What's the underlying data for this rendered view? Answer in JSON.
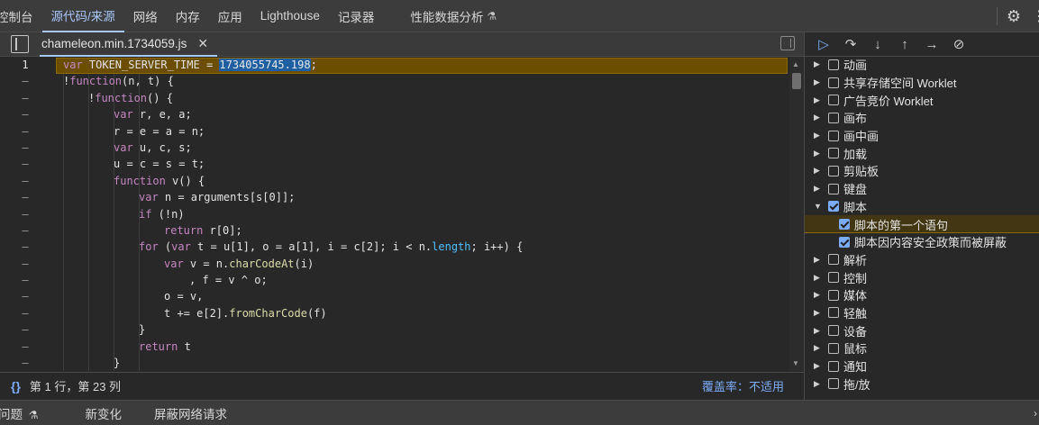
{
  "top_tabs": [
    {
      "label": "控制台",
      "active": false
    },
    {
      "label": "源代码/来源",
      "active": true
    },
    {
      "label": "网络",
      "active": false
    },
    {
      "label": "内存",
      "active": false
    },
    {
      "label": "应用",
      "active": false
    },
    {
      "label": "Lighthouse",
      "active": false
    },
    {
      "label": "记录器",
      "active": false
    },
    {
      "label": "性能数据分析",
      "active": false,
      "icon": "flask-icon"
    }
  ],
  "editor": {
    "file_tab": "chameleon.min.1734059.js",
    "gutter_first": "1",
    "gutter_rest": "–"
  },
  "code_lines": [
    "var TOKEN_SERVER_TIME = 1734055745.198;",
    "!function(n, t) {",
    "!function() {",
    "var r, e, a;",
    "r = e = a = n;",
    "var u, c, s;",
    "u = c = s = t;",
    "function v() {",
    "var n = arguments[s[0]];",
    "if (!n)",
    "return r[0];",
    "for (var t = u[1], o = a[1], i = c[2]; i < n.length; i++) {",
    "var v = n.charCodeAt(i)",
    ", f = v ^ o;",
    "o = v,",
    "t += e[2].fromCharCode(f)",
    "}",
    "return t",
    "}"
  ],
  "status": {
    "braces": "{}",
    "position": "第 1 行，第 23 列",
    "coverage": "覆盖率：不适用"
  },
  "breakpoints": [
    {
      "label": "动画",
      "checked": false,
      "expanded": false
    },
    {
      "label": "共享存储空间 Worklet",
      "checked": false,
      "expanded": false
    },
    {
      "label": "广告竞价 Worklet",
      "checked": false,
      "expanded": false
    },
    {
      "label": "画布",
      "checked": false,
      "expanded": false
    },
    {
      "label": "画中画",
      "checked": false,
      "expanded": false
    },
    {
      "label": "加载",
      "checked": false,
      "expanded": false
    },
    {
      "label": "剪贴板",
      "checked": false,
      "expanded": false
    },
    {
      "label": "键盘",
      "checked": false,
      "expanded": false
    },
    {
      "label": "脚本",
      "checked": true,
      "expanded": true
    },
    {
      "label": "脚本的第一个语句",
      "checked": true,
      "child": true,
      "highlight": true
    },
    {
      "label": "脚本因内容安全政策而被屏蔽",
      "checked": true,
      "child": true
    },
    {
      "label": "解析",
      "checked": false,
      "expanded": false
    },
    {
      "label": "控制",
      "checked": false,
      "expanded": false
    },
    {
      "label": "媒体",
      "checked": false,
      "expanded": false
    },
    {
      "label": "轻触",
      "checked": false,
      "expanded": false
    },
    {
      "label": "设备",
      "checked": false,
      "expanded": false
    },
    {
      "label": "鼠标",
      "checked": false,
      "expanded": false
    },
    {
      "label": "通知",
      "checked": false,
      "expanded": false
    },
    {
      "label": "拖/放",
      "checked": false,
      "expanded": false
    }
  ],
  "drawer_tabs": [
    "问题",
    "新变化",
    "屏蔽网络请求"
  ],
  "colors": {
    "accent": "#a8c7fa",
    "highlight_line": "#6b4e00",
    "checkbox_on": "#7cacf8"
  }
}
